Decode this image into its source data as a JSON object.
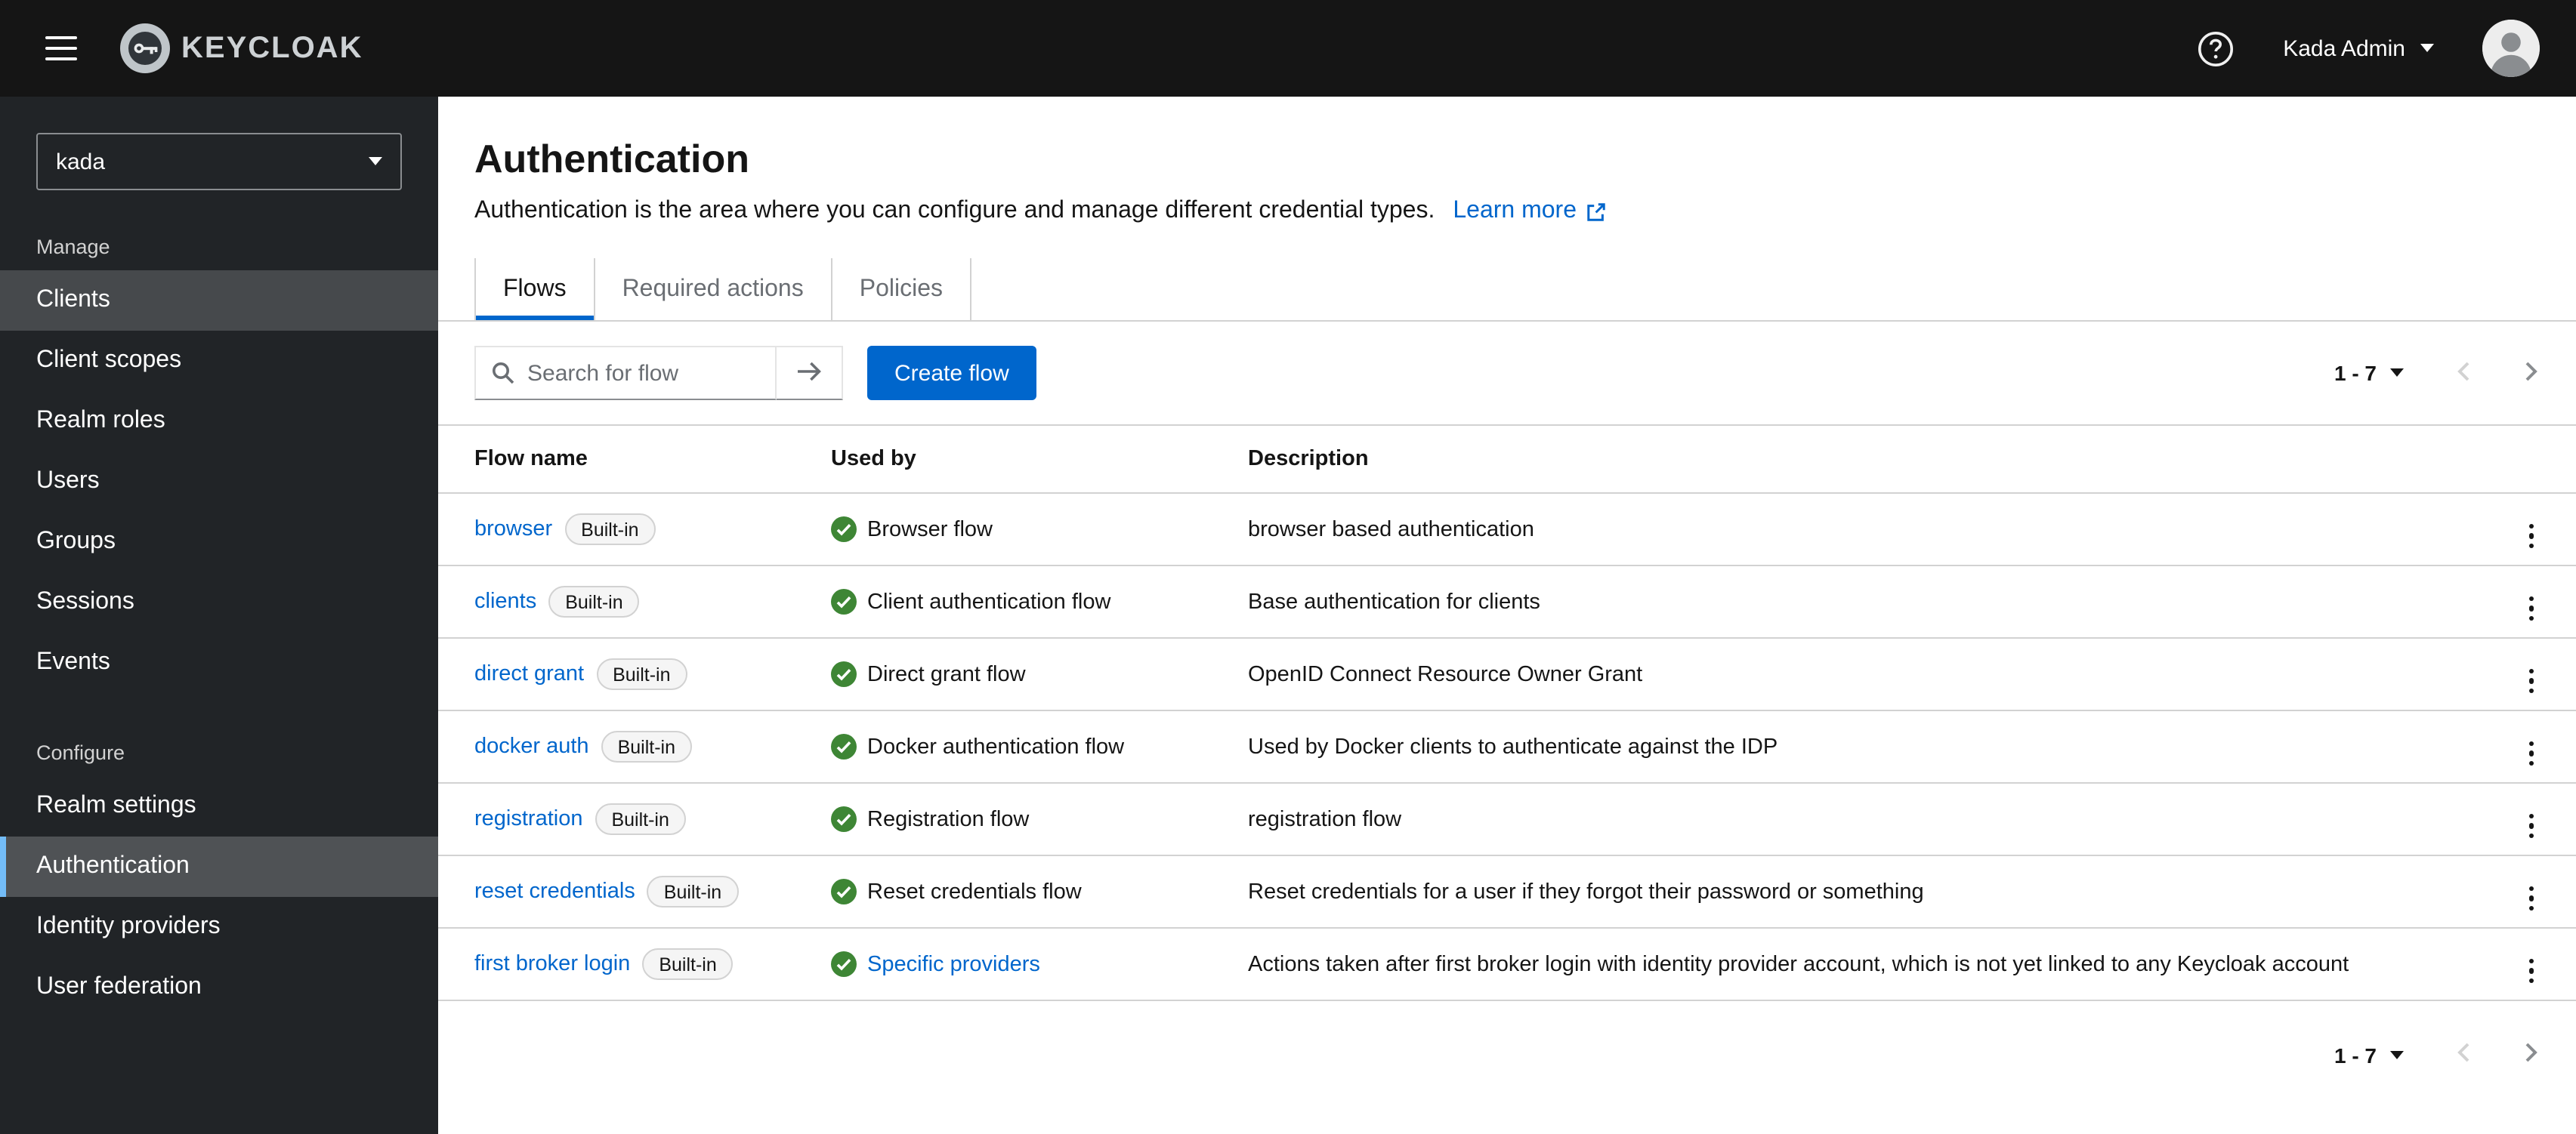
{
  "colors": {
    "primary": "#0066cc",
    "link": "#0066cc",
    "success": "#3e8635",
    "topbar_bg": "#151515",
    "sidebar_bg": "#212427",
    "sidebar_selected_bg": "#4f5255",
    "sidebar_selected_border": "#73bcf7",
    "border": "#d2d2d2"
  },
  "topbar": {
    "brand": "KEYCLOAK",
    "user": "Kada Admin"
  },
  "sidebar": {
    "realm": "kada",
    "sections": [
      {
        "label": "Manage",
        "items": [
          {
            "label": "Clients",
            "state": "highlighted"
          },
          {
            "label": "Client scopes",
            "state": "normal"
          },
          {
            "label": "Realm roles",
            "state": "normal"
          },
          {
            "label": "Users",
            "state": "normal"
          },
          {
            "label": "Groups",
            "state": "normal"
          },
          {
            "label": "Sessions",
            "state": "normal"
          },
          {
            "label": "Events",
            "state": "normal"
          }
        ]
      },
      {
        "label": "Configure",
        "items": [
          {
            "label": "Realm settings",
            "state": "normal"
          },
          {
            "label": "Authentication",
            "state": "current"
          },
          {
            "label": "Identity providers",
            "state": "normal"
          },
          {
            "label": "User federation",
            "state": "normal"
          }
        ]
      }
    ]
  },
  "page": {
    "title": "Authentication",
    "subtitle": "Authentication is the area where you can configure and manage different credential types.",
    "learn_more": "Learn more",
    "tabs": [
      "Flows",
      "Required actions",
      "Policies"
    ],
    "active_tab": "Flows"
  },
  "toolbar": {
    "search_placeholder": "Search for flow",
    "create_button": "Create flow",
    "pagination": "1 - 7"
  },
  "table": {
    "columns": [
      "Flow name",
      "Used by",
      "Description"
    ],
    "badge": "Built-in",
    "rows": [
      {
        "name": "browser",
        "used_by": "Browser flow",
        "used_by_link": false,
        "description": "browser based authentication"
      },
      {
        "name": "clients",
        "used_by": "Client authentication flow",
        "used_by_link": false,
        "description": "Base authentication for clients"
      },
      {
        "name": "direct grant",
        "used_by": "Direct grant flow",
        "used_by_link": false,
        "description": "OpenID Connect Resource Owner Grant"
      },
      {
        "name": "docker auth",
        "used_by": "Docker authentication flow",
        "used_by_link": false,
        "description": "Used by Docker clients to authenticate against the IDP"
      },
      {
        "name": "registration",
        "used_by": "Registration flow",
        "used_by_link": false,
        "description": "registration flow"
      },
      {
        "name": "reset credentials",
        "used_by": "Reset credentials flow",
        "used_by_link": false,
        "description": "Reset credentials for a user if they forgot their password or something"
      },
      {
        "name": "first broker login",
        "used_by": "Specific providers",
        "used_by_link": true,
        "description": "Actions taken after first broker login with identity provider account, which is not yet linked to any Keycloak account"
      }
    ]
  },
  "footer": {
    "pagination": "1 - 7"
  }
}
